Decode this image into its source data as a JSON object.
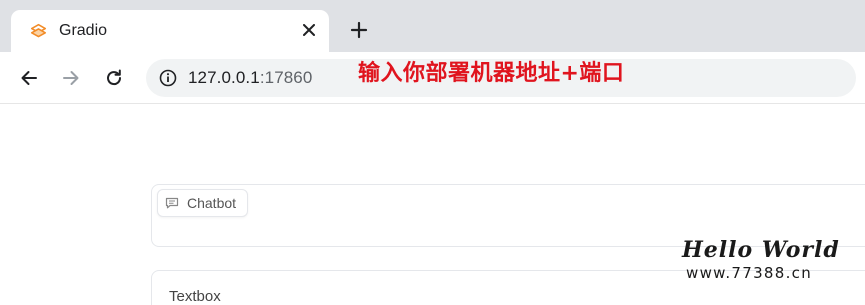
{
  "browser": {
    "tab": {
      "title": "Gradio",
      "icon": "gradio-logo-icon",
      "close_icon": "close-icon"
    },
    "new_tab_icon": "plus-icon",
    "toolbar": {
      "back_icon": "back-arrow-icon",
      "forward_icon": "forward-arrow-icon",
      "reload_icon": "reload-icon",
      "site_info_icon": "info-icon",
      "url_host": "127.0.0.1",
      "url_port": ":17860"
    }
  },
  "annotation": {
    "text": "输入你部署机器地址+端口",
    "color": "#e0141e"
  },
  "app": {
    "chatbot": {
      "label": "Chatbot",
      "icon": "chat-bubble-icon"
    },
    "textbox": {
      "label": "Textbox"
    }
  },
  "watermark": {
    "title": "Hello World",
    "url": "www.77388.cn"
  }
}
